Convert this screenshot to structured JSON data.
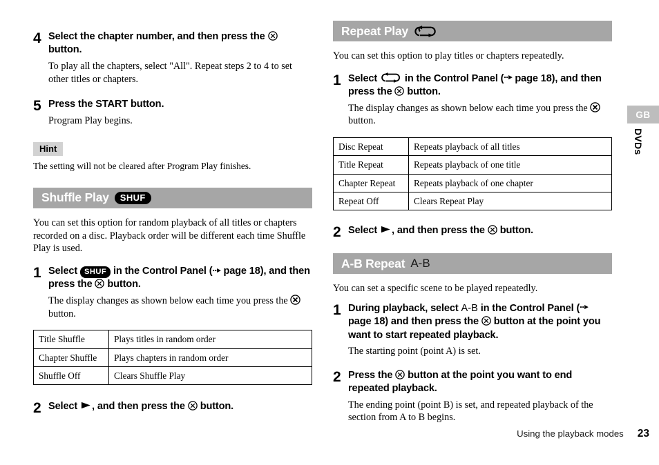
{
  "page": {
    "number": "23",
    "footer_label": "Using the playback modes",
    "side_tab_label": "GB",
    "side_vertical_label": "DVDs",
    "colors": {
      "section_bar": "#a6a6a6",
      "hint_badge": "#d2d2d2",
      "side_tab": "#bdbdbd",
      "text": "#000000"
    }
  },
  "left_column": {
    "step4": {
      "number": "4",
      "head_1": "Select the chapter number, and then press the",
      "head_2": "button.",
      "sub": "To play all the chapters, select \"All\". Repeat steps 2 to 4 to set other titles or chapters."
    },
    "step5": {
      "number": "5",
      "head": "Press the START button.",
      "sub": "Program Play begins."
    },
    "hint": {
      "badge": "Hint",
      "text": "The setting will not be cleared after Program Play finishes."
    },
    "shuffle": {
      "title": "Shuffle Play",
      "icon_label": "SHUF",
      "intro": "You can set this option for random playback of all titles or chapters recorded on a disc. Playback order will be different each time Shuffle Play is used.",
      "step1": {
        "number": "1",
        "head_a": "Select",
        "head_b": "in the Control Panel (",
        "head_c": "page 18), and then press the",
        "head_d": "button.",
        "sub_a": "The display changes as shown below each time you press the",
        "sub_b": "button."
      },
      "table": {
        "rows": [
          {
            "mode": "Title Shuffle",
            "description": "Plays titles in random order"
          },
          {
            "mode": "Chapter Shuffle",
            "description": "Plays chapters in random order"
          },
          {
            "mode": "Shuffle Off",
            "description": "Clears Shuffle Play"
          }
        ]
      },
      "step2": {
        "number": "2",
        "head_a": "Select",
        "head_b": ", and then press the",
        "head_c": "button."
      }
    }
  },
  "right_column": {
    "repeat": {
      "title": "Repeat Play",
      "icon_label": "repeat-loop",
      "intro": "You can set this option to play titles or chapters repeatedly.",
      "step1": {
        "number": "1",
        "head_a": "Select",
        "head_b": "in the Control Panel (",
        "head_c": "page 18), and then press the",
        "head_d": "button.",
        "sub_a": "The display changes as shown below each time you press the",
        "sub_b": "button."
      },
      "table": {
        "rows": [
          {
            "mode": "Disc Repeat",
            "description": "Repeats playback of all titles"
          },
          {
            "mode": "Title Repeat",
            "description": "Repeats playback of one title"
          },
          {
            "mode": "Chapter Repeat",
            "description": "Repeats playback of one chapter"
          },
          {
            "mode": "Repeat Off",
            "description": "Clears Repeat Play"
          }
        ]
      },
      "step2": {
        "number": "2",
        "head_a": "Select",
        "head_b": ", and then press the",
        "head_c": "button."
      }
    },
    "ab_repeat": {
      "title": "A-B Repeat",
      "icon_label": "A-B",
      "intro": "You can set a specific scene to be played repeatedly.",
      "step1": {
        "number": "1",
        "head_a": "During playback, select",
        "head_b": "in the Control Panel",
        "head_c": "(",
        "head_d": "page 18) and then press the",
        "head_e": "button at the point you want to start repeated playback.",
        "sub": "The starting point (point A) is set."
      },
      "step2": {
        "number": "2",
        "head_a": "Press the",
        "head_b": "button at the point you want to end repeated playback.",
        "sub": "The ending point (point B) is set, and repeated playback of the section from A to B begins."
      }
    }
  }
}
